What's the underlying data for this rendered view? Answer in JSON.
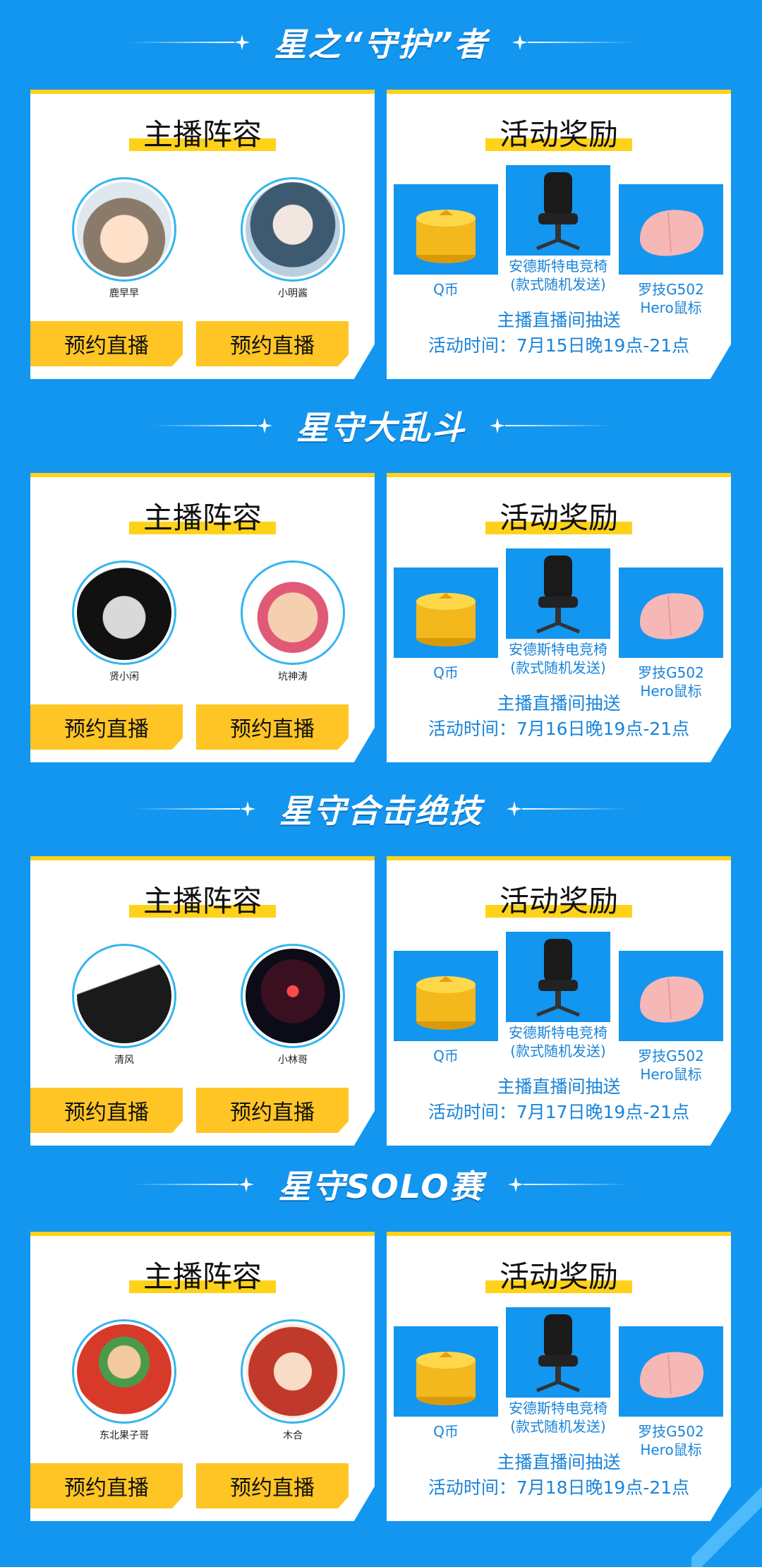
{
  "common": {
    "lineup_title": "主播阵容",
    "reward_title": "活动奖励",
    "book_button": "预约直播",
    "prizes": {
      "coin": "Q币",
      "chair_line1": "安德斯特电竞椅",
      "chair_line2": "(款式随机发送)",
      "mouse_line1": "罗技G502",
      "mouse_line2": "Hero鼠标"
    },
    "draw_note": "主播直播间抽送"
  },
  "sections": [
    {
      "title": "星之“守护”者",
      "streamers": [
        "鹿早早",
        "小明酱"
      ],
      "time": "活动时间：7月15日晚19点-21点"
    },
    {
      "title": "星守大乱斗",
      "streamers": [
        "贤小闲",
        "坑神涛"
      ],
      "time": "活动时间：7月16日晚19点-21点"
    },
    {
      "title": "星守合击绝技",
      "streamers": [
        "清风",
        "小林哥"
      ],
      "time": "活动时间：7月17日晚19点-21点"
    },
    {
      "title": "星守SOLO赛",
      "streamers": [
        "东北果子哥",
        "木合"
      ],
      "time": "活动时间：7月18日晚19点-21点"
    }
  ],
  "colors": {
    "background": "#1296f0",
    "accent_yellow": "#ffd21a",
    "button_yellow": "#ffc524",
    "text_blue": "#1a84d8"
  }
}
